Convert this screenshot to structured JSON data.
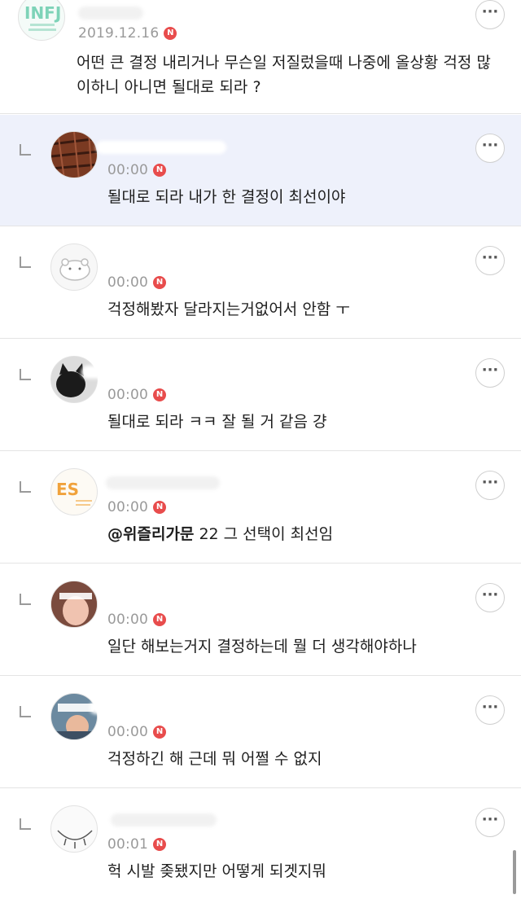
{
  "comments": [
    {
      "is_reply": false,
      "highlighted": false,
      "date": "2019.12.16",
      "new_badge": "N",
      "text": "어떤 큰 결정 내리거나 무슨일 저질렀을때 나중에 올상황 걱정 많이하니 아니면 될대로 되라 ?",
      "avatar_label": "INFJ",
      "more_label": "···"
    },
    {
      "is_reply": true,
      "highlighted": true,
      "time": "00:00",
      "new_badge": "N",
      "text": "될대로 되라 내가 한 결정이 최선이야",
      "more_label": "···"
    },
    {
      "is_reply": true,
      "highlighted": false,
      "time": "00:00",
      "new_badge": "N",
      "text": "걱정해봤자 달라지는거없어서 안함 ㅜ",
      "more_label": "···"
    },
    {
      "is_reply": true,
      "highlighted": false,
      "time": "00:00",
      "new_badge": "N",
      "text": "될대로 되라 ㅋㅋ 잘 될 거 같음 걍",
      "more_label": "···"
    },
    {
      "is_reply": true,
      "highlighted": false,
      "time": "00:00",
      "new_badge": "N",
      "mention": "@위즐리가문",
      "text": " 22 그 선택이 최선임",
      "more_label": "···",
      "avatar_label": "ES"
    },
    {
      "is_reply": true,
      "highlighted": false,
      "time": "00:00",
      "new_badge": "N",
      "text": "일단 해보는거지 결정하는데 뭘 더 생각해야하나",
      "more_label": "···"
    },
    {
      "is_reply": true,
      "highlighted": false,
      "time": "00:00",
      "new_badge": "N",
      "text": "걱정하긴 해 근데 뭐 어쩔 수 없지",
      "more_label": "···"
    },
    {
      "is_reply": true,
      "highlighted": false,
      "time": "00:01",
      "new_badge": "N",
      "text": "헉 시발 좆됐지만 어떻게 되겟지뭐",
      "more_label": "···"
    }
  ]
}
